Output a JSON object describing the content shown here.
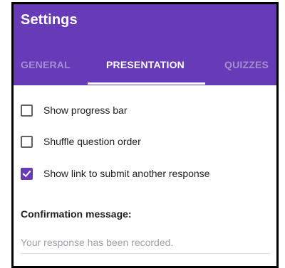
{
  "header": {
    "title": "Settings"
  },
  "tabs": [
    {
      "label": "GENERAL",
      "active": false
    },
    {
      "label": "PRESENTATION",
      "active": true
    },
    {
      "label": "QUIZZES",
      "active": false
    }
  ],
  "options": [
    {
      "label": "Show progress bar",
      "checked": false
    },
    {
      "label": "Shuffle question order",
      "checked": false
    },
    {
      "label": "Show link to submit another response",
      "checked": true
    }
  ],
  "confirmation": {
    "label": "Confirmation message:",
    "placeholder": "Your response has been recorded.",
    "value": ""
  },
  "colors": {
    "accent": "#673ab7",
    "inactive_tab": "#a48fd1",
    "text": "#202124",
    "placeholder": "#9aa0a6"
  },
  "icons": {
    "checkbox_checked": "check-icon"
  }
}
